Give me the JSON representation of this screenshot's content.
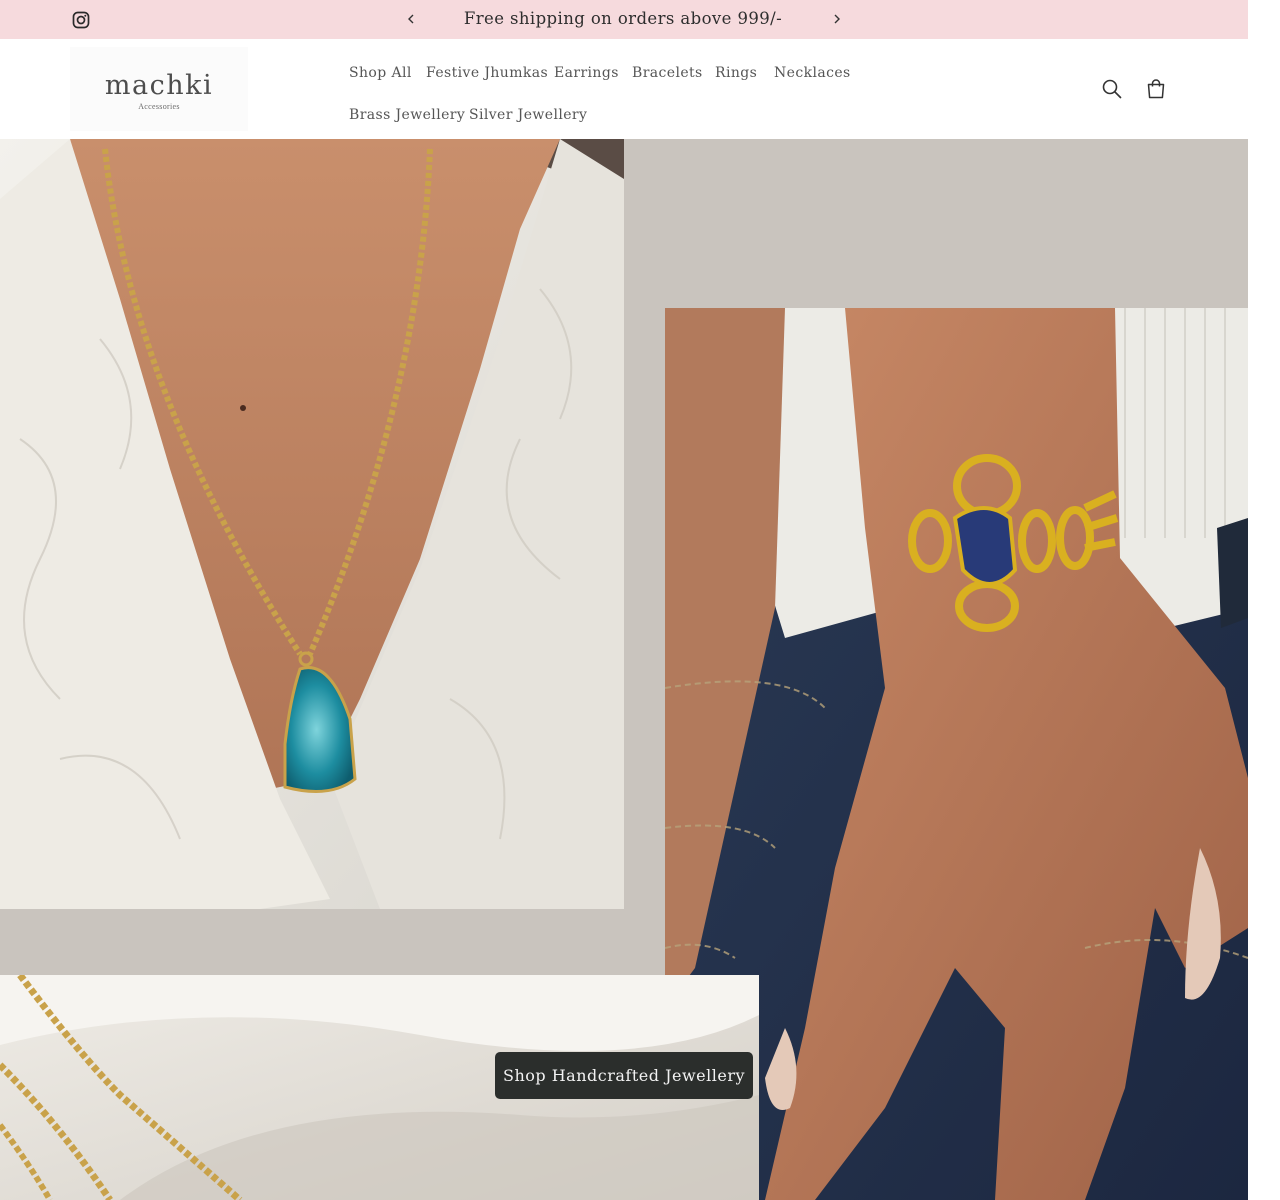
{
  "announcement": {
    "message": "Free shipping on orders above 999/-",
    "background": "#f6dadd"
  },
  "header": {
    "logo_text": "machki",
    "logo_subtext": "Accessories",
    "nav": [
      "Shop All",
      "Festive Jhumkas",
      "Earrings",
      "Bracelets",
      "Rings",
      "Necklaces",
      "Brass Jewellery",
      "Silver Jewellery"
    ]
  },
  "icons": {
    "social": "instagram-icon",
    "prev": "chevron-left-icon",
    "next": "chevron-right-icon",
    "search": "search-icon",
    "cart": "cart-icon"
  },
  "hero": {
    "background": "#c9c4be",
    "cta_label": "Shop Handcrafted Jewellery",
    "cta_color": "#2b2e2c"
  }
}
